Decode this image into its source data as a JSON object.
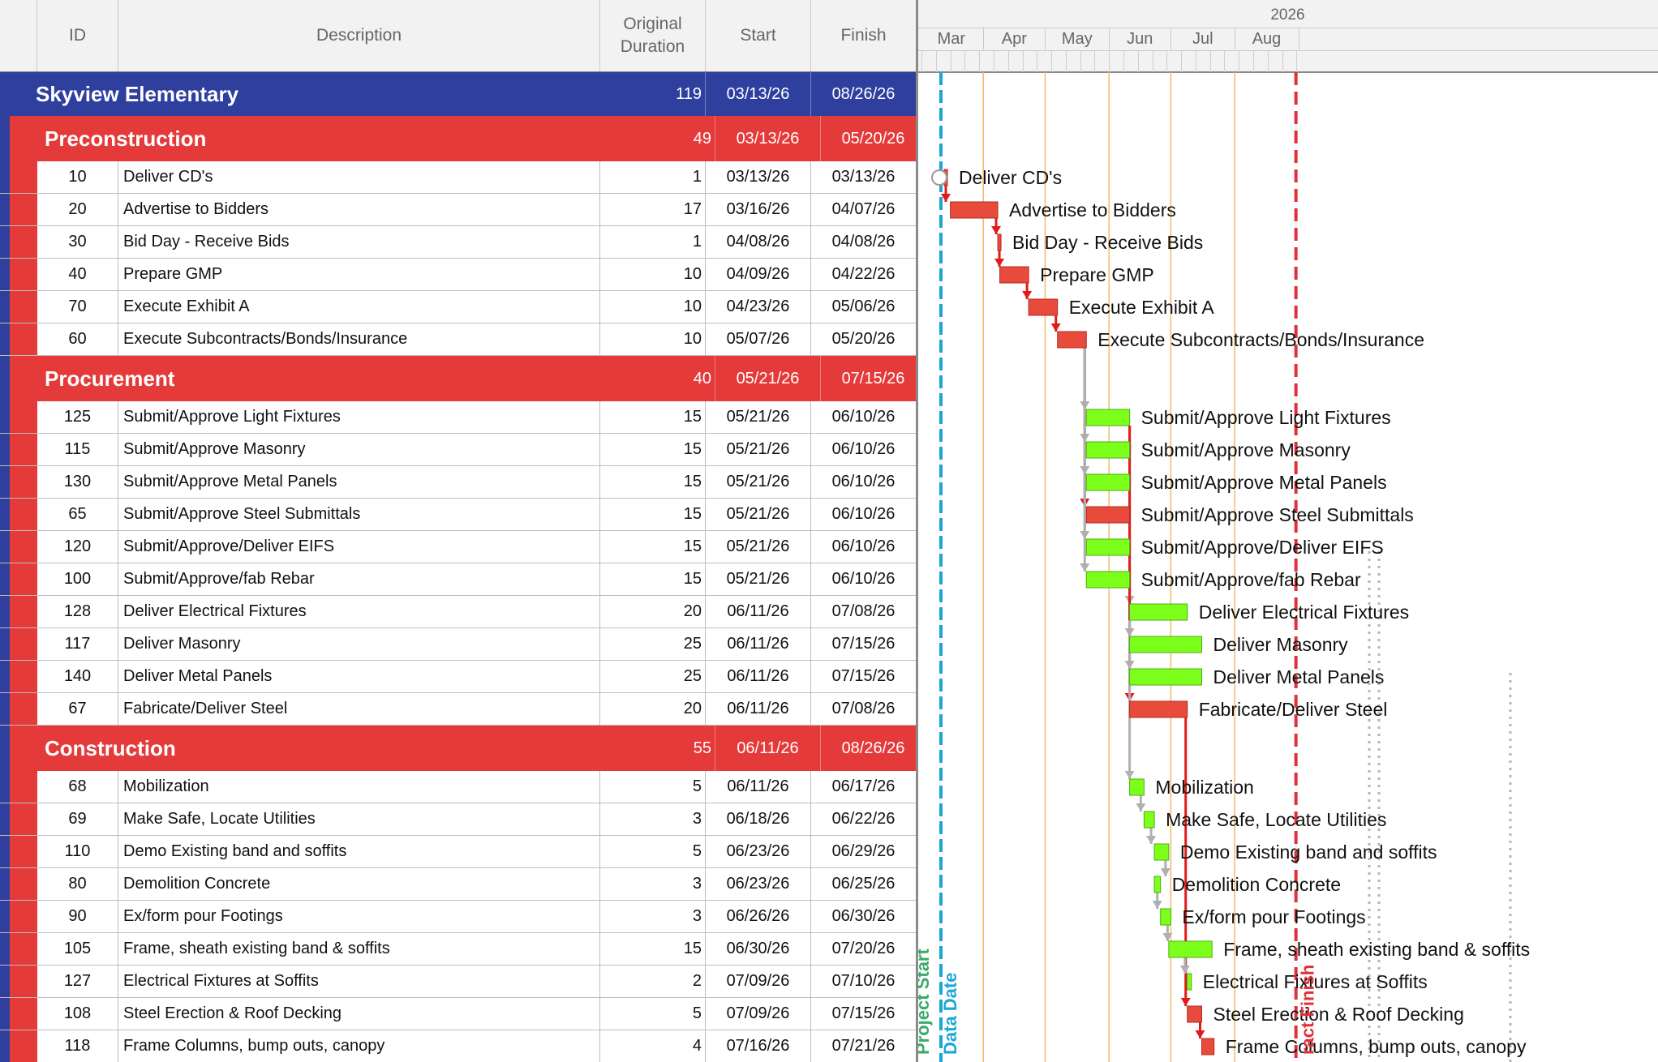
{
  "header": {
    "id": "ID",
    "description": "Description",
    "duration_line1": "Original",
    "duration_line2": "Duration",
    "start": "Start",
    "finish": "Finish",
    "year": "2026",
    "months": [
      "Mar",
      "Apr",
      "May",
      "Jun",
      "Jul",
      "Aug"
    ]
  },
  "colors": {
    "project": "#2f3f9e",
    "phase": "#e53a3a",
    "critical_bar": "#e84b3c",
    "noncritical_bar": "#7cff1a",
    "data_date": "#1aa7d6",
    "project_start": "#3aaa6a",
    "finish_line": "#e0303a",
    "month_line": "#f5b86a"
  },
  "markers": {
    "project_start": "Project Start",
    "data_date": "Data Date",
    "finish": "ract Finish"
  },
  "project": {
    "name": "Skyview Elementary",
    "duration": "119",
    "start": "03/13/26",
    "finish": "08/26/26"
  },
  "phases": [
    {
      "name": "Preconstruction",
      "duration": "49",
      "start": "03/13/26",
      "finish": "05/20/26",
      "tasks": [
        {
          "id": "10",
          "description": "Deliver CD's",
          "duration": "1",
          "start": "03/13/26",
          "finish": "03/13/26",
          "critical": true
        },
        {
          "id": "20",
          "description": "Advertise to Bidders",
          "duration": "17",
          "start": "03/16/26",
          "finish": "04/07/26",
          "critical": true
        },
        {
          "id": "30",
          "description": "Bid Day - Receive Bids",
          "duration": "1",
          "start": "04/08/26",
          "finish": "04/08/26",
          "critical": true
        },
        {
          "id": "40",
          "description": "Prepare GMP",
          "duration": "10",
          "start": "04/09/26",
          "finish": "04/22/26",
          "critical": true
        },
        {
          "id": "70",
          "description": "Execute Exhibit A",
          "duration": "10",
          "start": "04/23/26",
          "finish": "05/06/26",
          "critical": true
        },
        {
          "id": "60",
          "description": "Execute Subcontracts/Bonds/Insurance",
          "duration": "10",
          "start": "05/07/26",
          "finish": "05/20/26",
          "critical": true
        }
      ]
    },
    {
      "name": "Procurement",
      "duration": "40",
      "start": "05/21/26",
      "finish": "07/15/26",
      "tasks": [
        {
          "id": "125",
          "description": "Submit/Approve Light Fixtures",
          "duration": "15",
          "start": "05/21/26",
          "finish": "06/10/26",
          "critical": false
        },
        {
          "id": "115",
          "description": "Submit/Approve Masonry",
          "duration": "15",
          "start": "05/21/26",
          "finish": "06/10/26",
          "critical": false
        },
        {
          "id": "130",
          "description": "Submit/Approve Metal Panels",
          "duration": "15",
          "start": "05/21/26",
          "finish": "06/10/26",
          "critical": false
        },
        {
          "id": "65",
          "description": "Submit/Approve Steel Submittals",
          "duration": "15",
          "start": "05/21/26",
          "finish": "06/10/26",
          "critical": true
        },
        {
          "id": "120",
          "description": "Submit/Approve/Deliver EIFS",
          "duration": "15",
          "start": "05/21/26",
          "finish": "06/10/26",
          "critical": false
        },
        {
          "id": "100",
          "description": "Submit/Approve/fab Rebar",
          "duration": "15",
          "start": "05/21/26",
          "finish": "06/10/26",
          "critical": false
        },
        {
          "id": "128",
          "description": "Deliver Electrical Fixtures",
          "duration": "20",
          "start": "06/11/26",
          "finish": "07/08/26",
          "critical": false
        },
        {
          "id": "117",
          "description": "Deliver Masonry",
          "duration": "25",
          "start": "06/11/26",
          "finish": "07/15/26",
          "critical": false
        },
        {
          "id": "140",
          "description": "Deliver Metal Panels",
          "duration": "25",
          "start": "06/11/26",
          "finish": "07/15/26",
          "critical": false
        },
        {
          "id": "67",
          "description": "Fabricate/Deliver Steel",
          "duration": "20",
          "start": "06/11/26",
          "finish": "07/08/26",
          "critical": true
        }
      ]
    },
    {
      "name": "Construction",
      "duration": "55",
      "start": "06/11/26",
      "finish": "08/26/26",
      "tasks": [
        {
          "id": "68",
          "description": "Mobilization",
          "duration": "5",
          "start": "06/11/26",
          "finish": "06/17/26",
          "critical": false
        },
        {
          "id": "69",
          "description": "Make Safe, Locate Utilities",
          "duration": "3",
          "start": "06/18/26",
          "finish": "06/22/26",
          "critical": false
        },
        {
          "id": "110",
          "description": "Demo Existing band and soffits",
          "duration": "5",
          "start": "06/23/26",
          "finish": "06/29/26",
          "critical": false
        },
        {
          "id": "80",
          "description": "Demolition Concrete",
          "duration": "3",
          "start": "06/23/26",
          "finish": "06/25/26",
          "critical": false
        },
        {
          "id": "90",
          "description": "Ex/form pour Footings",
          "duration": "3",
          "start": "06/26/26",
          "finish": "06/30/26",
          "critical": false
        },
        {
          "id": "105",
          "description": "Frame, sheath existing band & soffits",
          "duration": "15",
          "start": "06/30/26",
          "finish": "07/20/26",
          "critical": false
        },
        {
          "id": "127",
          "description": "Electrical Fixtures at Soffits",
          "duration": "2",
          "start": "07/09/26",
          "finish": "07/10/26",
          "critical": false
        },
        {
          "id": "108",
          "description": "Steel Erection & Roof Decking",
          "duration": "5",
          "start": "07/09/26",
          "finish": "07/15/26",
          "critical": true
        },
        {
          "id": "118",
          "description": "Frame Columns, bump outs, canopy",
          "duration": "4",
          "start": "07/16/26",
          "finish": "07/21/26",
          "critical": true
        }
      ]
    }
  ]
}
